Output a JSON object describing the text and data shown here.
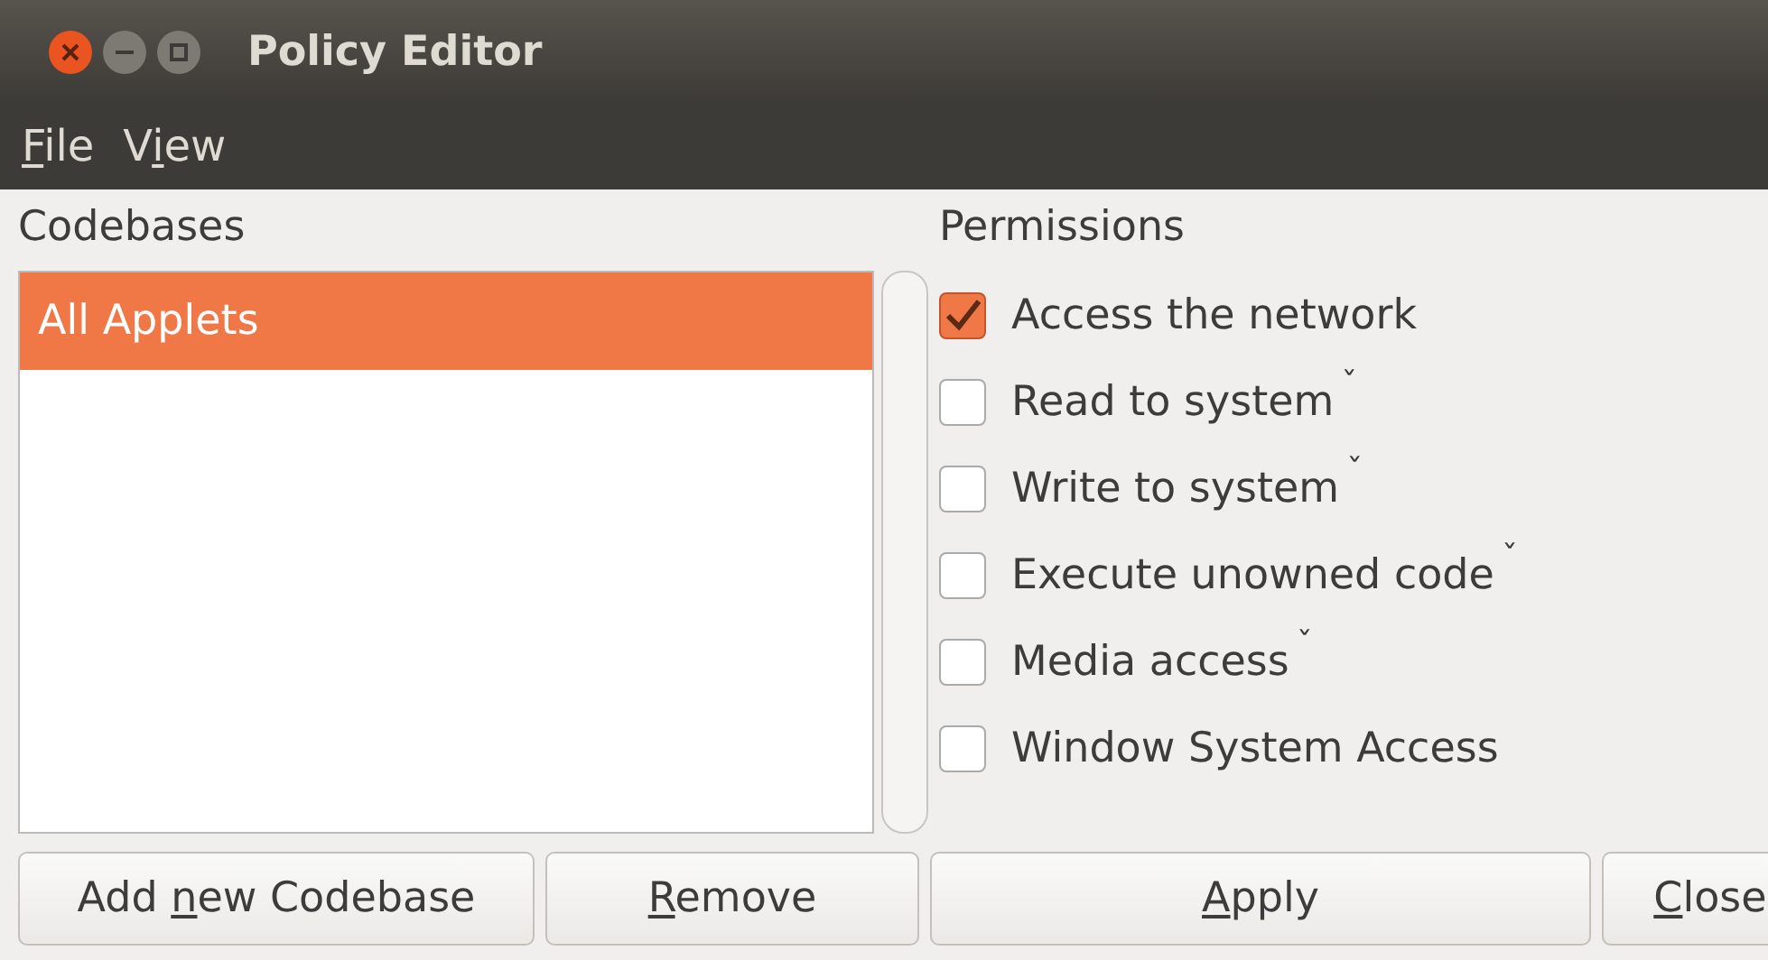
{
  "window": {
    "title": "Policy Editor"
  },
  "menu": [
    {
      "key": "F",
      "after": "ile"
    },
    {
      "before": "V",
      "key": "i",
      "after": "ew"
    }
  ],
  "codebases": {
    "heading": "Codebases",
    "items": [
      {
        "label": "All Applets",
        "selected": true
      }
    ]
  },
  "permissions": {
    "heading": "Permissions",
    "items": [
      {
        "label": "Access the network",
        "checked": true
      },
      {
        "label": "Read to system",
        "checked": false,
        "mark": "ˇ"
      },
      {
        "label": "Write to system",
        "checked": false,
        "mark": "ˇ"
      },
      {
        "label": "Execute unowned code",
        "checked": false,
        "mark": "ˇ"
      },
      {
        "label": "Media access",
        "checked": false,
        "mark": "ˇ"
      },
      {
        "label": "Window System Access",
        "checked": false
      }
    ]
  },
  "buttons": [
    {
      "before": "Add ",
      "key": "n",
      "after": "ew Codebase"
    },
    {
      "key": "R",
      "after": "emove"
    },
    {
      "key": "A",
      "after": "pply"
    },
    {
      "key": "C",
      "after": "lose"
    }
  ]
}
